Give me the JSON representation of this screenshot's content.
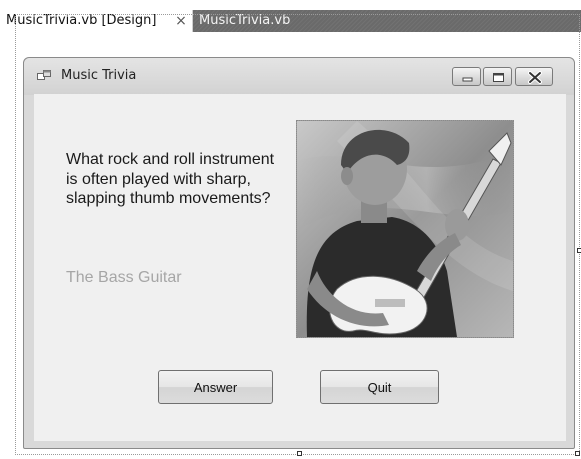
{
  "ide": {
    "tabs": [
      {
        "label": "MusicTrivia.vb [Design]",
        "active": true
      },
      {
        "label": "MusicTrivia.vb",
        "active": false
      }
    ],
    "close_glyph": "×"
  },
  "form": {
    "title": "Music Trivia",
    "icon": "form-window-icon",
    "window_buttons": [
      "minimize-icon",
      "maximize-icon",
      "close-icon"
    ],
    "question": "What rock and roll instrument is often played with sharp, slapping thumb movements?",
    "answer": "The Bass Guitar",
    "picture": "photo of a young man playing an electric bass guitar",
    "buttons": {
      "answer_label": "Answer",
      "quit_label": "Quit"
    }
  },
  "colors": {
    "inactive_tab": "#6e6e6e",
    "form_background": "#f0f0f0",
    "answer_text": "#a6a6a6"
  }
}
